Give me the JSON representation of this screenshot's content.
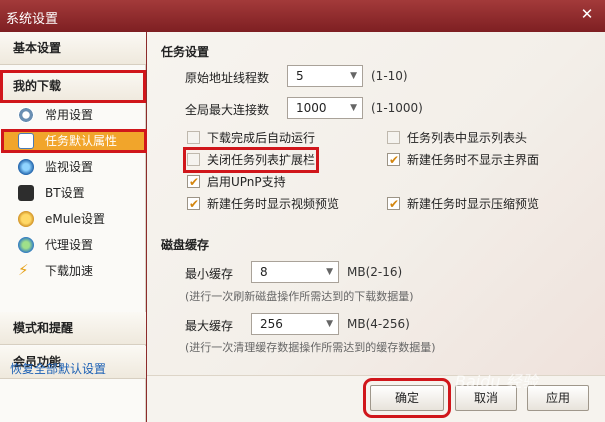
{
  "window": {
    "title": "系统设置",
    "close_glyph": "✕"
  },
  "sidebar": {
    "sections": {
      "basic": "基本设置",
      "downloads": "我的下载",
      "mode": "模式和提醒",
      "member": "会员功能"
    },
    "items": [
      {
        "label": "常用设置",
        "icon": "gear-icon"
      },
      {
        "label": "任务默认属性",
        "icon": "task-list-icon"
      },
      {
        "label": "监视设置",
        "icon": "monitor-icon"
      },
      {
        "label": "BT设置",
        "icon": "bt-icon"
      },
      {
        "label": "eMule设置",
        "icon": "emule-icon"
      },
      {
        "label": "代理设置",
        "icon": "proxy-icon"
      },
      {
        "label": "下载加速",
        "icon": "lightning-icon"
      }
    ],
    "restore_link": "恢复全部默认设置"
  },
  "task_settings": {
    "heading": "任务设置",
    "threads": {
      "label": "原始地址线程数",
      "value": "5",
      "range": "(1-10)"
    },
    "connections": {
      "label": "全局最大连接数",
      "value": "1000",
      "range": "(1-1000)"
    },
    "checkboxes": [
      {
        "label": "下载完成后自动运行",
        "checked": false
      },
      {
        "label": "任务列表中显示列表头",
        "checked": false
      },
      {
        "label": "关闭任务列表扩展栏",
        "checked": false
      },
      {
        "label": "新建任务时不显示主界面",
        "checked": true
      },
      {
        "label": "启用UPnP支持",
        "checked": true
      },
      {
        "label": "新建任务时显示视频预览",
        "checked": true
      },
      {
        "label": "新建任务时显示压缩预览",
        "checked": true
      }
    ]
  },
  "disk_cache": {
    "heading": "磁盘缓存",
    "min": {
      "label": "最小缓存",
      "value": "8",
      "range": "MB(2-16)",
      "hint": "(进行一次刷新磁盘操作所需达到的下载数据量)"
    },
    "max": {
      "label": "最大缓存",
      "value": "256",
      "range": "MB(4-256)",
      "hint": "(进行一次清理缓存数据操作所需达到的缓存数据量)"
    }
  },
  "buttons": {
    "ok": "确定",
    "cancel": "取消",
    "apply": "应用"
  },
  "watermark": "Baidu 经验",
  "colors": {
    "accent": "#f1a52b",
    "highlight": "#d0161b",
    "title_bar": "#8c2b2b",
    "link": "#1a5fb4"
  }
}
